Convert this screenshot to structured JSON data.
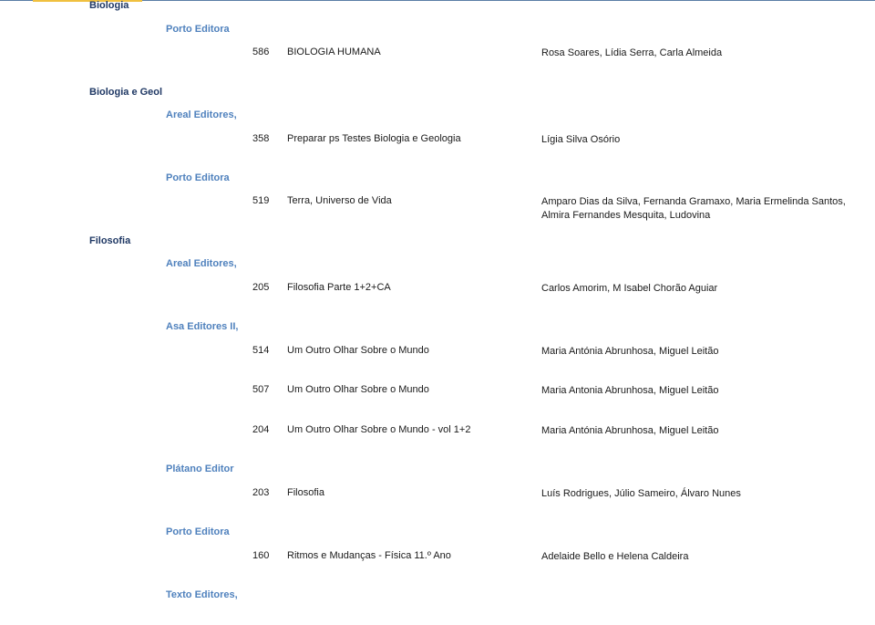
{
  "subjects": [
    {
      "name": "Biologia",
      "publishers": [
        {
          "name": "Porto Editora",
          "books": [
            {
              "number": "586",
              "title": "BIOLOGIA HUMANA",
              "authors": "Rosa Soares, Lídia Serra, Carla Almeida"
            }
          ]
        }
      ]
    },
    {
      "name": "Biologia e Geol",
      "publishers": [
        {
          "name": "Areal Editores,",
          "books": [
            {
              "number": "358",
              "title": "Preparar ps Testes Biologia e Geologia",
              "authors": "Lígia Silva Osório"
            }
          ]
        },
        {
          "name": "Porto Editora",
          "books": [
            {
              "number": "519",
              "title": "Terra, Universo de Vida",
              "authors": "Amparo Dias da Silva, Fernanda Gramaxo, Maria Ermelinda Santos, Almira Fernandes Mesquita, Ludovina"
            }
          ]
        }
      ]
    },
    {
      "name": "Filosofia",
      "publishers": [
        {
          "name": "Areal Editores,",
          "books": [
            {
              "number": "205",
              "title": "Filosofia Parte 1+2+CA",
              "authors": "Carlos Amorim, M Isabel Chorão Aguiar"
            }
          ]
        },
        {
          "name": "Asa Editores II,",
          "books": [
            {
              "number": "514",
              "title": "Um Outro Olhar Sobre o Mundo",
              "authors": "Maria Antónia Abrunhosa, Miguel Leitão"
            },
            {
              "number": "507",
              "title": "Um Outro Olhar Sobre o Mundo",
              "authors": "Maria Antonia Abrunhosa, Miguel Leitão"
            },
            {
              "number": "204",
              "title": "Um Outro Olhar Sobre o Mundo - vol 1+2",
              "authors": "Maria Antónia Abrunhosa, Miguel Leitão"
            }
          ]
        },
        {
          "name": "Plátano Editor",
          "books": [
            {
              "number": "203",
              "title": "Filosofia",
              "authors": "Luís Rodrigues, Júlio Sameiro, Álvaro Nunes"
            }
          ]
        },
        {
          "name": "Porto Editora",
          "books": [
            {
              "number": "160",
              "title": "Ritmos e Mudanças - Física 11.º Ano",
              "authors": "Adelaide Bello e Helena Caldeira"
            }
          ]
        },
        {
          "name": "Texto Editores,",
          "books": []
        }
      ]
    }
  ]
}
